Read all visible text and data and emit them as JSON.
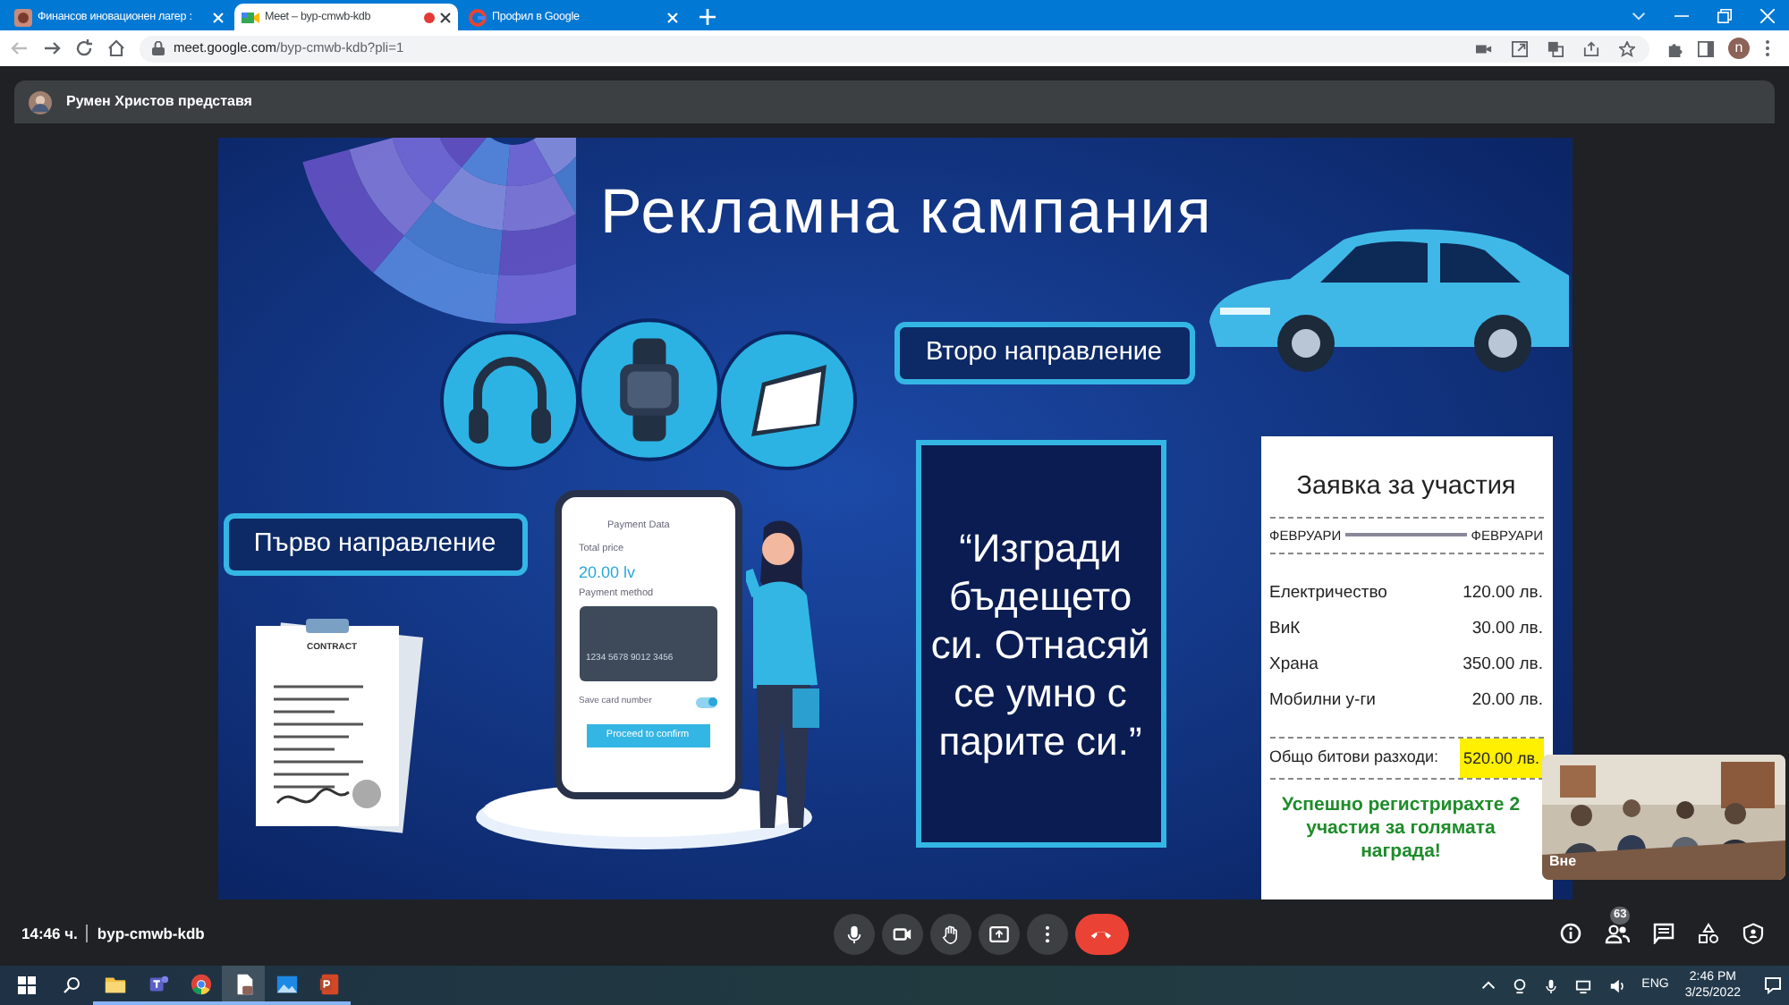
{
  "browser": {
    "tabs": [
      {
        "title": "Финансов иновационен лагер :",
        "selected": false,
        "recording": false
      },
      {
        "title": "Meet – byp-cmwb-kdb",
        "selected": true,
        "recording": true
      },
      {
        "title": "Профил в Google",
        "selected": false,
        "recording": false
      }
    ],
    "url_host": "meet.google.com",
    "url_path": "/byp-cmwb-kdb?pli=1",
    "profile_initial": "n"
  },
  "presenter": {
    "label": "Румен Христов представя"
  },
  "slide": {
    "title": "Рекламна кампания",
    "direction_1": "Първо направление",
    "direction_2": "Второ направление",
    "quote": "“Изгради бъдещето си. Отнасяй се умно с парите си.”",
    "phone": {
      "header": "Payment Data",
      "total_label": "Total price",
      "total": "20.00 lv",
      "method_label": "Payment method",
      "card_number": "1234 5678 9012 3456",
      "save_label": "Save card number",
      "save_on": true,
      "button": "Proceed to confirm"
    },
    "contract_title": "CONTRACT",
    "receipt": {
      "title": "Заявка за участия",
      "from": "ФЕВРУАРИ",
      "to": "ФЕВРУАРИ",
      "items": [
        {
          "label": "Електричество",
          "amount": "120.00 лв."
        },
        {
          "label": "ВиК",
          "amount": "30.00 лв."
        },
        {
          "label": "Храна",
          "amount": "350.00 лв."
        },
        {
          "label": "Мобилни у-ги",
          "amount": "20.00 лв."
        }
      ],
      "total_label": "Общо битови разходи:",
      "total": "520.00 лв.",
      "message": "Успешно регистрирахте 2 участия за голямата награда!"
    }
  },
  "video_tile": {
    "label": "Вне"
  },
  "meeting": {
    "time": "14:46 ч.",
    "code": "byp-cmwb-kdb",
    "participants": "63"
  },
  "taskbar": {
    "language": "ENG",
    "time": "2:46 PM",
    "date": "3/25/2022"
  }
}
